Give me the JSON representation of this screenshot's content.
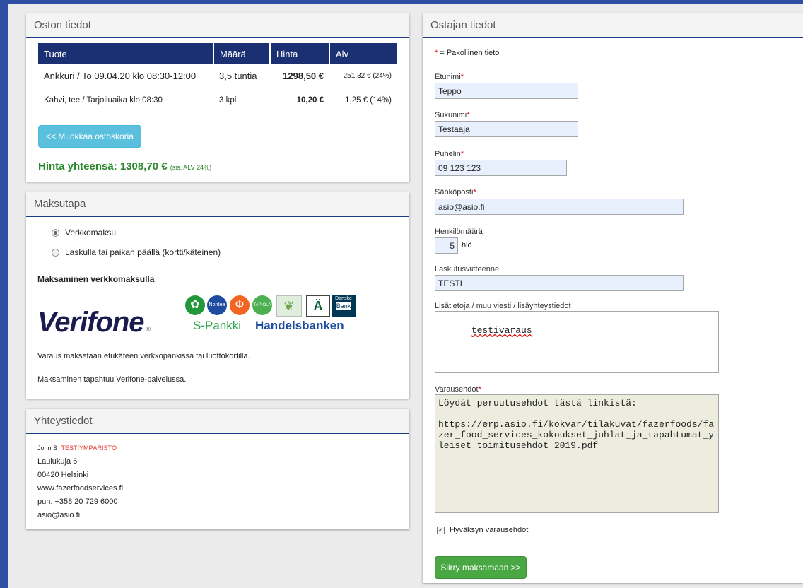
{
  "purchase": {
    "title": "Oston tiedot",
    "columns": [
      "Tuote",
      "Määrä",
      "Hinta",
      "Alv"
    ],
    "rows": [
      {
        "product": "Ankkuri / To 09.04.20 klo 08:30-12:00",
        "qty": "3,5 tuntia",
        "price": "1298,50 €",
        "vat": "251,32 € (24%)"
      },
      {
        "product": "Kahvi, tee / Tarjoiluaika klo 08:30",
        "qty": "3 kpl",
        "price": "10,20 €",
        "vat": "1,25 € (14%)"
      }
    ],
    "edit_button": "<< Muokkaa ostoskoria",
    "total_label": "Hinta yhteensä: 1308,70 €",
    "total_note": "(sis. ALV 24%)"
  },
  "payment": {
    "title": "Maksutapa",
    "options": [
      "Verkkomaksu",
      "Laskulla tai paikan päällä (kortti/käteinen)"
    ],
    "selected": "Verkkomaksu",
    "heading": "Maksaminen verkkomaksulla",
    "verifone": "Verifone",
    "bank_text_1": "S-Pankki",
    "bank_text_2": "Handelsbanken",
    "note1": "Varaus maksetaan etukäteen verkkopankissa tai luottokortilla.",
    "note2": "Maksaminen tapahtuu Verifone-palvelussa."
  },
  "contact": {
    "title": "Yhteystiedot",
    "name": "John S",
    "env": "TESTIYMPÄRISTÖ",
    "lines": [
      "Laulukuja 6",
      "00420 Helsinki",
      "www.fazerfoodservices.fi",
      "puh. +358 20 729 6000",
      "asio@asio.fi"
    ]
  },
  "buyer": {
    "title": "Ostajan tiedot",
    "required_note": "= Pakollinen tieto",
    "first_name_label": "Etunimi",
    "first_name": "Teppo",
    "last_name_label": "Sukunimi",
    "last_name": "Testaaja",
    "phone_label": "Puhelin",
    "phone": "09 123 123",
    "email_label": "Sähköposti",
    "email": "asio@asio.fi",
    "people_label": "Henkilömäärä",
    "people": "5",
    "people_unit": "hlö",
    "invoice_ref_label": "Laskutusviitteenne",
    "invoice_ref": "TESTI",
    "extra_label": "Lisätietoja / muu viesti / lisäyhteystiedot",
    "extra": "testivaraus",
    "terms_label": "Varausehdot",
    "terms": "Löydät peruutusehdot tästä linkistä:\n\nhttps://erp.asio.fi/kokvar/tilakuvat/fazerfoods/fazer_food_services_kokoukset_juhlat_ja_tapahtumat_yleiset_toimitusehdot_2019.pdf",
    "accept_label": "Hyväksyn varausehdot",
    "submit": "Siirry maksamaan >>"
  },
  "colors": {
    "header_blue": "#1b2f73",
    "accent_green": "#2b8a2b",
    "button_blue": "#5bc0de",
    "button_green": "#49a843",
    "required_red": "#dd0000"
  }
}
